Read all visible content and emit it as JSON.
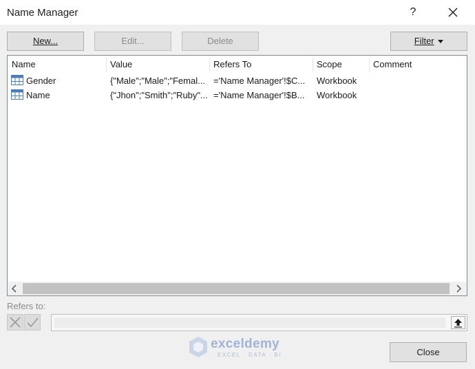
{
  "window": {
    "title": "Name Manager",
    "help_label": "?"
  },
  "toolbar": {
    "new_label": "New...",
    "edit_label": "Edit...",
    "delete_label": "Delete",
    "filter_label": "Filter"
  },
  "table": {
    "columns": [
      "Name",
      "Value",
      "Refers To",
      "Scope",
      "Comment"
    ],
    "rows": [
      {
        "name": "Gender",
        "value": "{\"Male\";\"Male\";\"Femal...",
        "refers_to": "='Name Manager'!$C...",
        "scope": "Workbook",
        "comment": ""
      },
      {
        "name": "Name",
        "value": "{\"Jhon\";\"Smith\";\"Ruby\"...",
        "refers_to": "='Name Manager'!$B...",
        "scope": "Workbook",
        "comment": ""
      }
    ]
  },
  "refers_to": {
    "label": "Refers to:",
    "value": ""
  },
  "footer": {
    "close_label": "Close"
  },
  "watermark": {
    "brand": "exceldemy",
    "tagline": "EXCEL · DATA · BI"
  },
  "icons": {
    "row_icon": "named-range-table-icon",
    "cancel": "x-cancel-icon",
    "confirm": "check-confirm-icon",
    "collapse": "collapse-dialog-icon"
  }
}
